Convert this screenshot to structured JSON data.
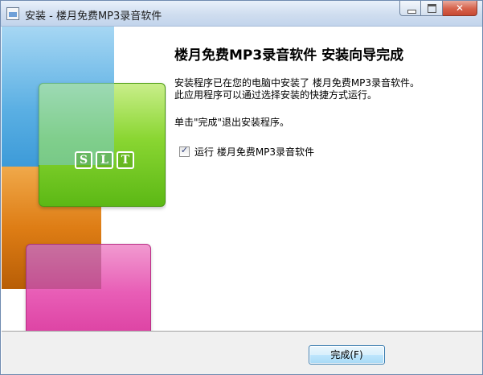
{
  "window": {
    "title": "安装 - 楼月免费MP3录音软件",
    "controls": {
      "minimize_icon": "minimize-icon",
      "maximize_icon": "maximize-icon",
      "close_glyph": "✕"
    }
  },
  "sidebar": {
    "logo_letters": [
      "S",
      "L",
      "T"
    ]
  },
  "main": {
    "heading": "楼月免费MP3录音软件 安装向导完成",
    "description_lines": [
      "安装程序已在您的电脑中安装了 楼月免费MP3录音软件。",
      "此应用程序可以通过选择安装的快捷方式运行。"
    ],
    "click_hint": "单击\"完成\"退出安装程序。",
    "run_checkbox": {
      "label": "运行 楼月免费MP3录音软件",
      "checked": true,
      "checkmark": "✓"
    }
  },
  "footer": {
    "finish_label": "完成(F)"
  },
  "colors": {
    "accent_blue": "#3c9ad8",
    "accent_green": "#8ad632",
    "accent_orange": "#de7d15",
    "accent_pink": "#e85db6"
  }
}
